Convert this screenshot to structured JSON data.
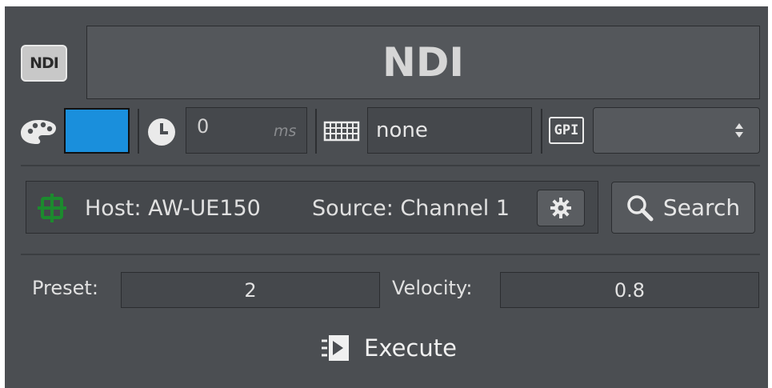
{
  "header": {
    "badge": "NDI",
    "title": "NDI"
  },
  "row_options": {
    "color": "#1a8fdc",
    "delay_value": "0",
    "delay_unit": "ms",
    "hotkey_value": "none",
    "gpi_label": "GPI",
    "gpi_value": ""
  },
  "source": {
    "host_label": "Host: AW-UE150",
    "source_label": "Source: Channel 1",
    "search_label": "Search"
  },
  "params": {
    "preset_label": "Preset:",
    "preset_value": "2",
    "velocity_label": "Velocity:",
    "velocity_value": "0.8"
  },
  "execute_label": "Execute"
}
